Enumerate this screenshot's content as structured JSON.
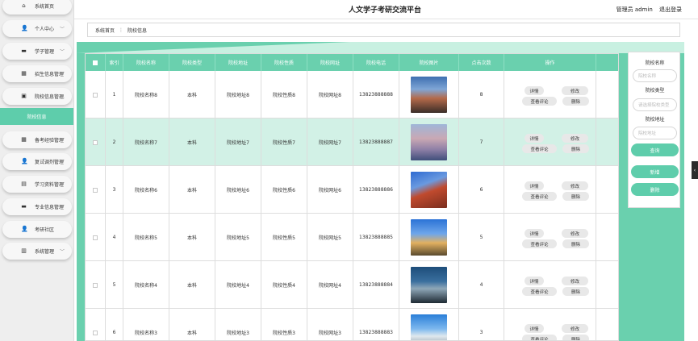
{
  "header": {
    "title": "人文学子考研交流平台",
    "user": "管理员 admin",
    "logout": "退出登录"
  },
  "sidebar": {
    "items": [
      {
        "label": "系统首页",
        "icon": "home-icon",
        "glyph": "⌂"
      },
      {
        "label": "个人中心",
        "icon": "user-icon",
        "glyph": "👤"
      },
      {
        "label": "学子管理",
        "icon": "student-icon",
        "glyph": "▬"
      },
      {
        "label": "招生信息管理",
        "icon": "grid-icon",
        "glyph": "▦"
      },
      {
        "label": "院校信息管理",
        "icon": "school-icon",
        "glyph": "▣"
      },
      {
        "label": "备考经验管理",
        "icon": "grid-icon",
        "glyph": "▦"
      },
      {
        "label": "复试调剂管理",
        "icon": "user-icon",
        "glyph": "👤"
      },
      {
        "label": "学习资料管理",
        "icon": "book-icon",
        "glyph": "▤"
      },
      {
        "label": "专业信息管理",
        "icon": "folder-icon",
        "glyph": "▬"
      },
      {
        "label": "考研社区",
        "icon": "user-icon",
        "glyph": "👤"
      },
      {
        "label": "系统管理",
        "icon": "chart-icon",
        "glyph": "▥"
      }
    ],
    "active_sub": "院校信息"
  },
  "breadcrumb": {
    "home": "系统首页",
    "current": "院校信息"
  },
  "table": {
    "headers": [
      "索引",
      "院校名称",
      "院校类型",
      "院校地址",
      "院校性质",
      "院校网址",
      "院校电话",
      "院校图片",
      "点击次数",
      "操作"
    ],
    "rows": [
      {
        "index": "1",
        "name": "院校名称8",
        "type": "本科",
        "address": "院校地址8",
        "nature": "院校性质8",
        "url": "院校网址8",
        "phone": "13823888888",
        "clicks": "8"
      },
      {
        "index": "2",
        "name": "院校名称7",
        "type": "本科",
        "address": "院校地址7",
        "nature": "院校性质7",
        "url": "院校网址7",
        "phone": "13823888887",
        "clicks": "7"
      },
      {
        "index": "3",
        "name": "院校名称6",
        "type": "本科",
        "address": "院校地址6",
        "nature": "院校性质6",
        "url": "院校网址6",
        "phone": "13823888886",
        "clicks": "6"
      },
      {
        "index": "4",
        "name": "院校名称5",
        "type": "本科",
        "address": "院校地址5",
        "nature": "院校性质5",
        "url": "院校网址5",
        "phone": "13823888885",
        "clicks": "5"
      },
      {
        "index": "5",
        "name": "院校名称4",
        "type": "本科",
        "address": "院校地址4",
        "nature": "院校性质4",
        "url": "院校网址4",
        "phone": "13823888884",
        "clicks": "4"
      },
      {
        "index": "6",
        "name": "院校名称3",
        "type": "本科",
        "address": "院校地址3",
        "nature": "院校性质3",
        "url": "院校网址3",
        "phone": "13823888883",
        "clicks": "3"
      }
    ],
    "actions": {
      "detail": "详情",
      "edit": "修改",
      "comments": "查看评论",
      "delete": "删除"
    }
  },
  "search_panel": {
    "name_label": "院校名称",
    "name_placeholder": "院校名称",
    "type_label": "院校类型",
    "type_placeholder": "请选择院校类型",
    "address_label": "院校地址",
    "address_placeholder": "院校地址",
    "search_button": "查询",
    "add_button": "新增",
    "delete_button": "删除"
  },
  "colors": {
    "accent": "#5ecdab",
    "header_bg": "#6ad0ae",
    "highlight_row": "#d2f1e6"
  }
}
